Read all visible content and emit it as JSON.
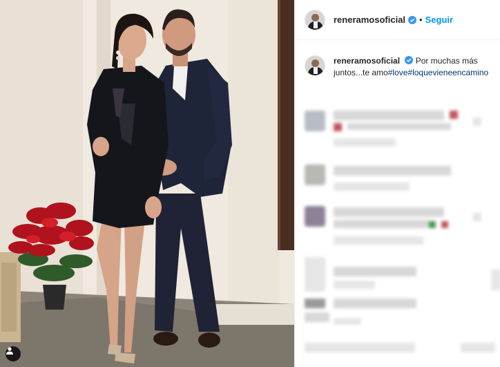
{
  "post": {
    "username": "reneramosoficial",
    "follow_label": "Seguir",
    "separator": "•",
    "caption": {
      "username": "reneramosoficial",
      "text": "Por muchas más juntos...te amo",
      "hashtags": [
        "#love",
        "#loquevieneencamino"
      ]
    }
  },
  "icons": {
    "verified": "verified-badge-icon",
    "user_tag": "user-tag-icon"
  },
  "colors": {
    "verified": "#3897f0",
    "follow": "#0095f6",
    "hashtag": "#00376b"
  }
}
